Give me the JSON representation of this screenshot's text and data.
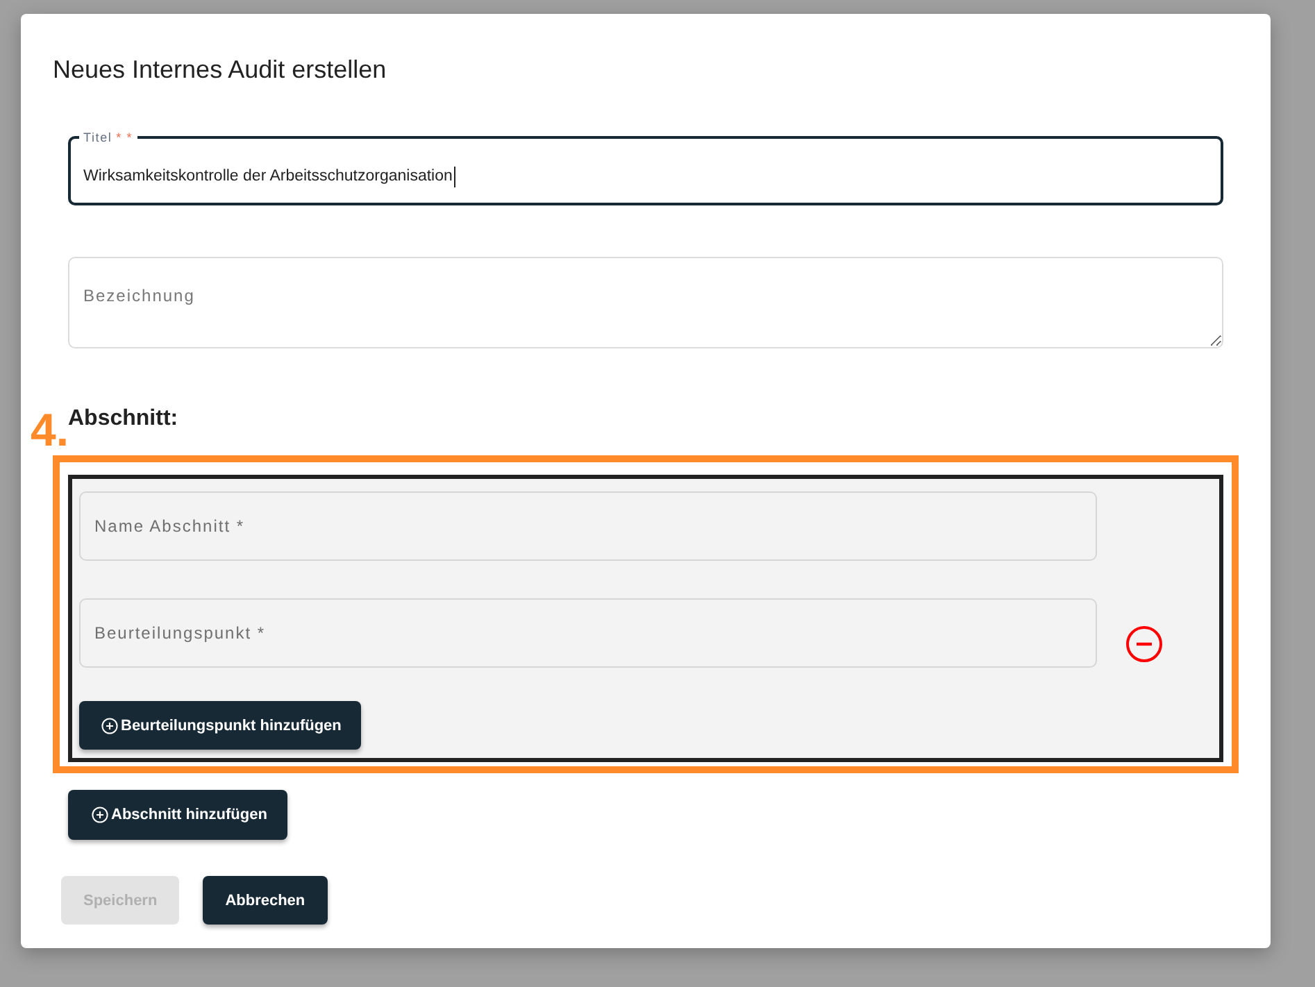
{
  "dialog": {
    "title": "Neues Internes Audit erstellen"
  },
  "title_field": {
    "label": "Titel",
    "required_mark": "* *",
    "value": "Wirksamkeitskontrolle der Arbeitsschutzorganisation",
    "focused": true
  },
  "description_field": {
    "placeholder": "Bezeichnung",
    "focused": false
  },
  "sections_heading": "Abschnitt:",
  "annotation": {
    "label": "4."
  },
  "sections": [
    {
      "name_field": {
        "placeholder": "Name Abschnitt *"
      },
      "points": [
        {
          "placeholder": "Beurteilungspunkt *",
          "removable": true
        }
      ],
      "add_point_button": {
        "label": "Beurteilungspunkt hinzufügen"
      }
    }
  ],
  "add_section_button": {
    "label": "Abschnitt hinzufügen"
  },
  "actions": [
    {
      "label": "Speichern",
      "disabled": true
    },
    {
      "label": "Abbrechen",
      "disabled": false
    }
  ]
}
